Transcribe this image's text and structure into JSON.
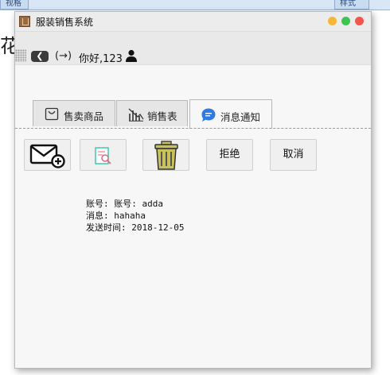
{
  "background_app": {
    "tab_left": "视格",
    "tab_right": "样式",
    "left_text": "花图"
  },
  "window": {
    "title": "服装销售系统",
    "controls": [
      "minimize",
      "maximize",
      "close"
    ]
  },
  "toolbar": {
    "back_glyph": "❮",
    "forward_glyph": "(→)",
    "greeting": "你好,123"
  },
  "tabs": [
    {
      "label": "售卖商品",
      "icon": "shopping-bag-icon",
      "active": false
    },
    {
      "label": "销售表",
      "icon": "bar-chart-icon",
      "active": false
    },
    {
      "label": "消息通知",
      "icon": "chat-bubble-icon",
      "active": true
    }
  ],
  "actions": {
    "new_message_icon": "mail-add-icon",
    "search_icon": "search-document-icon",
    "delete_icon": "trash-icon",
    "reject_label": "拒绝",
    "cancel_label": "取消"
  },
  "message": {
    "account_line": "账号: 账号: adda",
    "content_line": "消息: hahaha",
    "time_line": "发送时间: 2018-12-05"
  },
  "colors": {
    "chat_icon": "#2f7be6",
    "trash": "#c9c15a",
    "close_dot": "#f1574f",
    "min_dot": "#f5b73a",
    "max_dot": "#3cc551"
  }
}
